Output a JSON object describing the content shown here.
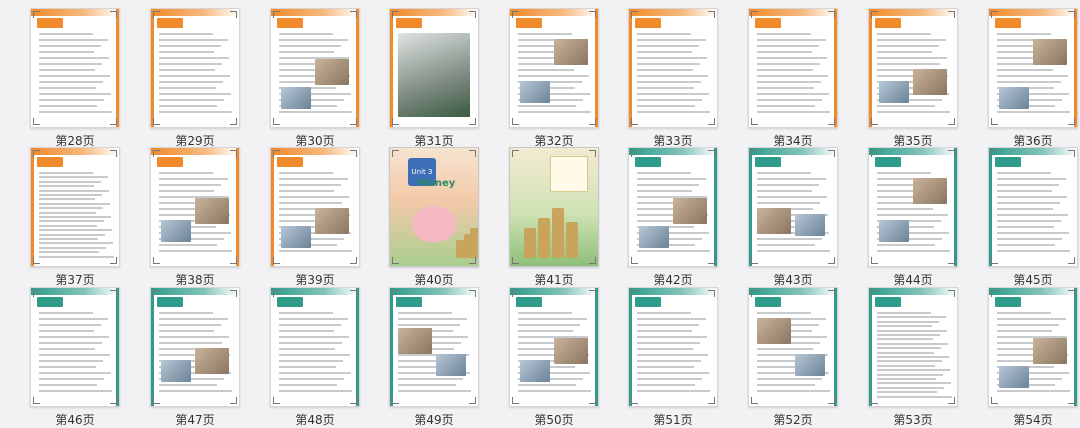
{
  "thumbnails": [
    {
      "label": "第28页",
      "theme": "#f08a2a",
      "kind": "text"
    },
    {
      "label": "第29页",
      "theme": "#f08a2a",
      "kind": "text"
    },
    {
      "label": "第30页",
      "theme": "#f08a2a",
      "kind": "text-img"
    },
    {
      "label": "第31页",
      "theme": "#f08a2a",
      "kind": "photo"
    },
    {
      "label": "第32页",
      "theme": "#f08a2a",
      "kind": "text-img"
    },
    {
      "label": "第33页",
      "theme": "#f08a2a",
      "kind": "text"
    },
    {
      "label": "第34页",
      "theme": "#f08a2a",
      "kind": "text"
    },
    {
      "label": "第35页",
      "theme": "#f08a2a",
      "kind": "text-img"
    },
    {
      "label": "第36页",
      "theme": "#f08a2a",
      "kind": "text-img"
    },
    {
      "label": "第37页",
      "theme": "#f08a2a",
      "kind": "lines"
    },
    {
      "label": "第38页",
      "theme": "#f08a2a",
      "kind": "text-img"
    },
    {
      "label": "第39页",
      "theme": "#f08a2a",
      "kind": "text-img"
    },
    {
      "label": "第40页",
      "theme": "#55b08a",
      "kind": "cover-pig"
    },
    {
      "label": "第41页",
      "theme": "#55b08a",
      "kind": "cover-coins"
    },
    {
      "label": "第42页",
      "theme": "#2f9b8a",
      "kind": "text-img"
    },
    {
      "label": "第43页",
      "theme": "#2f9b8a",
      "kind": "text-img"
    },
    {
      "label": "第44页",
      "theme": "#2f9b8a",
      "kind": "text-img"
    },
    {
      "label": "第45页",
      "theme": "#2f9b8a",
      "kind": "text"
    },
    {
      "label": "第46页",
      "theme": "#2f9b8a",
      "kind": "text"
    },
    {
      "label": "第47页",
      "theme": "#2f9b8a",
      "kind": "text-img"
    },
    {
      "label": "第48页",
      "theme": "#2f9b8a",
      "kind": "text"
    },
    {
      "label": "第49页",
      "theme": "#2f9b8a",
      "kind": "text-img"
    },
    {
      "label": "第50页",
      "theme": "#2f9b8a",
      "kind": "text-img"
    },
    {
      "label": "第51页",
      "theme": "#2f9b8a",
      "kind": "text"
    },
    {
      "label": "第52页",
      "theme": "#2f9b8a",
      "kind": "text-img"
    },
    {
      "label": "第53页",
      "theme": "#2f9b8a",
      "kind": "lines"
    },
    {
      "label": "第54页",
      "theme": "#2f9b8a",
      "kind": "text-img"
    }
  ],
  "cover": {
    "badge": "Unit 3",
    "title": "Money"
  }
}
